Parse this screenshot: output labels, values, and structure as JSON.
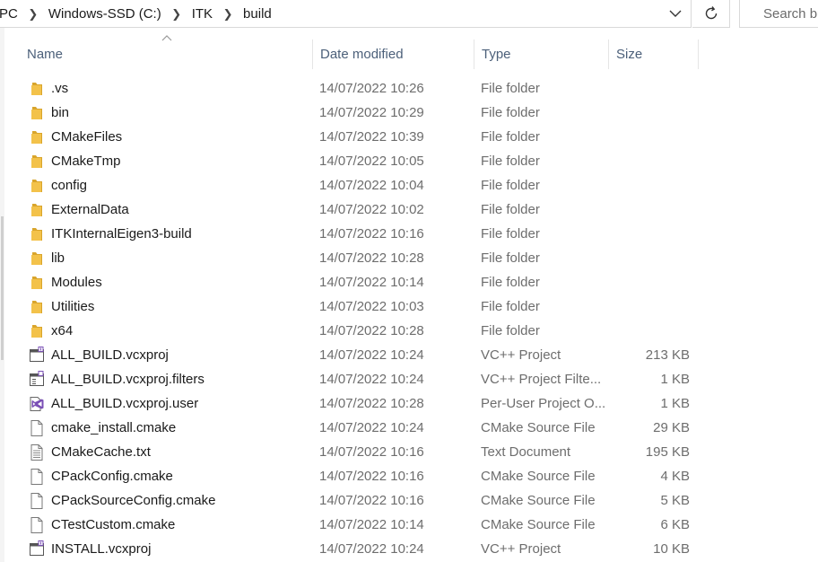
{
  "breadcrumb": {
    "items": [
      "PC",
      "Windows-SSD (C:)",
      "ITK",
      "build"
    ]
  },
  "search": {
    "placeholder": "Search build"
  },
  "columns": {
    "name": "Name",
    "date": "Date modified",
    "type": "Type",
    "size": "Size"
  },
  "colors": {
    "folder": "#f3c24a",
    "folder_dark": "#d9a52c",
    "header_text": "#4c607a",
    "muted_text": "#6d6d6d"
  },
  "files": [
    {
      "name": ".vs",
      "date": "14/07/2022 10:26",
      "type": "File folder",
      "size": "",
      "icon": "folder-icon"
    },
    {
      "name": "bin",
      "date": "14/07/2022 10:29",
      "type": "File folder",
      "size": "",
      "icon": "folder-icon"
    },
    {
      "name": "CMakeFiles",
      "date": "14/07/2022 10:39",
      "type": "File folder",
      "size": "",
      "icon": "folder-icon"
    },
    {
      "name": "CMakeTmp",
      "date": "14/07/2022 10:05",
      "type": "File folder",
      "size": "",
      "icon": "folder-icon"
    },
    {
      "name": "config",
      "date": "14/07/2022 10:04",
      "type": "File folder",
      "size": "",
      "icon": "folder-icon"
    },
    {
      "name": "ExternalData",
      "date": "14/07/2022 10:02",
      "type": "File folder",
      "size": "",
      "icon": "folder-icon"
    },
    {
      "name": "ITKInternalEigen3-build",
      "date": "14/07/2022 10:16",
      "type": "File folder",
      "size": "",
      "icon": "folder-icon"
    },
    {
      "name": "lib",
      "date": "14/07/2022 10:28",
      "type": "File folder",
      "size": "",
      "icon": "folder-icon"
    },
    {
      "name": "Modules",
      "date": "14/07/2022 10:14",
      "type": "File folder",
      "size": "",
      "icon": "folder-icon"
    },
    {
      "name": "Utilities",
      "date": "14/07/2022 10:03",
      "type": "File folder",
      "size": "",
      "icon": "folder-icon"
    },
    {
      "name": "x64",
      "date": "14/07/2022 10:28",
      "type": "File folder",
      "size": "",
      "icon": "folder-icon"
    },
    {
      "name": "ALL_BUILD.vcxproj",
      "date": "14/07/2022 10:24",
      "type": "VC++ Project",
      "size": "213 KB",
      "icon": "vcxproj-icon"
    },
    {
      "name": "ALL_BUILD.vcxproj.filters",
      "date": "14/07/2022 10:24",
      "type": "VC++ Project Filte...",
      "size": "1 KB",
      "icon": "vcxproj-filters-icon"
    },
    {
      "name": "ALL_BUILD.vcxproj.user",
      "date": "14/07/2022 10:28",
      "type": "Per-User Project O...",
      "size": "1 KB",
      "icon": "visual-studio-icon"
    },
    {
      "name": "cmake_install.cmake",
      "date": "14/07/2022 10:24",
      "type": "CMake Source File",
      "size": "29 KB",
      "icon": "document-icon"
    },
    {
      "name": "CMakeCache.txt",
      "date": "14/07/2022 10:16",
      "type": "Text Document",
      "size": "195 KB",
      "icon": "text-document-icon"
    },
    {
      "name": "CPackConfig.cmake",
      "date": "14/07/2022 10:16",
      "type": "CMake Source File",
      "size": "4 KB",
      "icon": "document-icon"
    },
    {
      "name": "CPackSourceConfig.cmake",
      "date": "14/07/2022 10:16",
      "type": "CMake Source File",
      "size": "5 KB",
      "icon": "document-icon"
    },
    {
      "name": "CTestCustom.cmake",
      "date": "14/07/2022 10:14",
      "type": "CMake Source File",
      "size": "6 KB",
      "icon": "document-icon"
    },
    {
      "name": "INSTALL.vcxproj",
      "date": "14/07/2022 10:24",
      "type": "VC++ Project",
      "size": "10 KB",
      "icon": "vcxproj-icon"
    }
  ]
}
